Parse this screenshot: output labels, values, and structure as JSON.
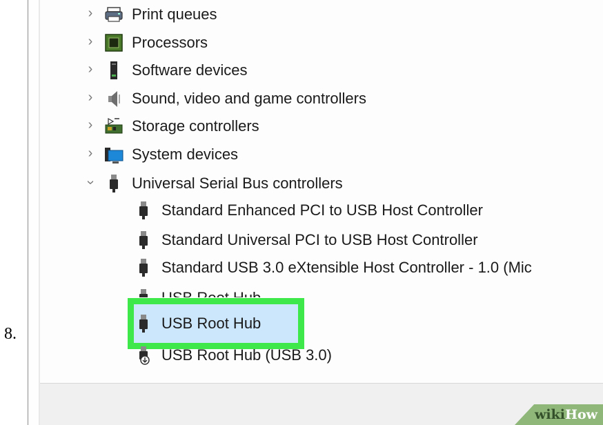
{
  "step_number": "8.",
  "device_manager": {
    "categories": [
      {
        "label": "Print queues",
        "icon": "printer-icon",
        "expanded": false
      },
      {
        "label": "Processors",
        "icon": "processor-icon",
        "expanded": false
      },
      {
        "label": "Software devices",
        "icon": "software-device-icon",
        "expanded": false
      },
      {
        "label": "Sound, video and game controllers",
        "icon": "speaker-icon",
        "expanded": false
      },
      {
        "label": "Storage controllers",
        "icon": "storage-controller-icon",
        "expanded": false
      },
      {
        "label": "System devices",
        "icon": "system-devices-icon",
        "expanded": false
      },
      {
        "label": "Universal Serial Bus controllers",
        "icon": "usb-icon",
        "expanded": true
      }
    ],
    "usb_children": [
      {
        "label": "Standard Enhanced PCI to USB Host Controller",
        "icon": "usb-icon"
      },
      {
        "label": "Standard Universal PCI to USB Host Controller",
        "icon": "usb-icon"
      },
      {
        "label": "Standard USB 3.0 eXtensible Host Controller - 1.0 (Mic",
        "icon": "usb-icon"
      },
      {
        "label": "USB Root Hub",
        "icon": "usb-icon",
        "partially_hidden": true
      },
      {
        "label": "USB Root Hub",
        "icon": "usb-icon",
        "selected": true
      },
      {
        "label": "USB Root Hub (USB 3.0)",
        "icon": "usb-disabled-icon"
      }
    ]
  },
  "watermark": {
    "part1": "wiki",
    "part2": "How"
  },
  "colors": {
    "highlight_border": "#3ee84b",
    "selection_bg": "#cce6fb",
    "watermark_bg": "#8fb77a"
  }
}
